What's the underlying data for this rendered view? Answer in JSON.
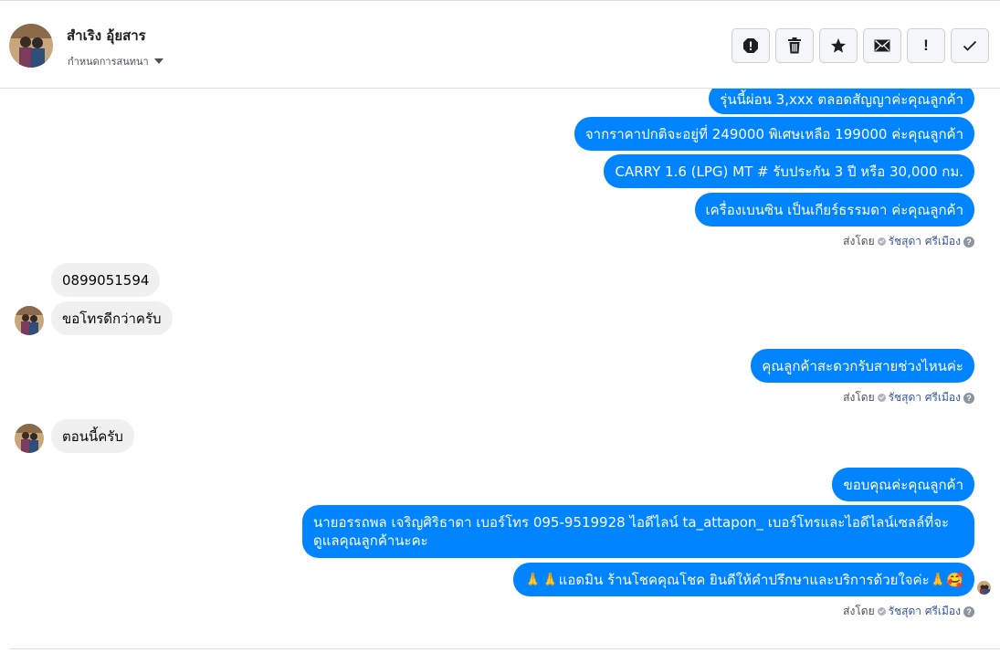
{
  "header": {
    "contact_name": "สำเริง อุ้ยสาร",
    "label_dropdown": "กำหนดการสนทนา",
    "toolbar_icons": [
      "alert-icon",
      "trash-icon",
      "star-icon",
      "envelope-icon",
      "exclamation-icon",
      "check-icon"
    ],
    "exclamation_glyph": "!"
  },
  "messages": {
    "m1": "รุ่นนี้ผ่อน 3,xxx ตลอดสัญญาค่ะคุณลูกค้า",
    "m2": "จากราคาปกติจะอยู่ที่ 249000 พิเศษเหลือ 199000  ค่ะคุณลูกค้า",
    "m3": "CARRY 1.6 (LPG) MT # รับประกัน 3 ปี หรือ 30,000 กม.",
    "m4": "เครื่องเบนซิน   เป็นเกียร์ธรรมดา ค่ะคุณลูกค้า",
    "m5": "0899051594",
    "m6": "ขอโทรดีกว่าครับ",
    "m7": "คุณลูกค้าสะดวกรับสายช่วงไหนค่ะ",
    "m8": "ตอนนี้ครับ",
    "m9": "ขอบคุณค่ะคุณลูกค้า",
    "m10": "นายอรรถพล เจริญศิริธาดา     เบอร์โทร 095-9519928 ไอดีไลน์ ta_attapon_  เบอร์โทรและไอดีไลน์เซลล์ที่จะดูแลคุณลูกค้านะคะ",
    "m11": "🙏🙏แอดมิน ร้านโชคคุณโชค ยินดีให้คำปรึกษาและบริการด้วยใจค่ะ🙏🥰"
  },
  "sent_by": {
    "prefix": "ส่งโดย",
    "name": "รัชสุดา ศรีเมือง",
    "help": "?"
  },
  "colors": {
    "outgoing_bubble": "#0084ff",
    "incoming_bubble": "#f1f0f0",
    "sender_link": "#385898"
  }
}
